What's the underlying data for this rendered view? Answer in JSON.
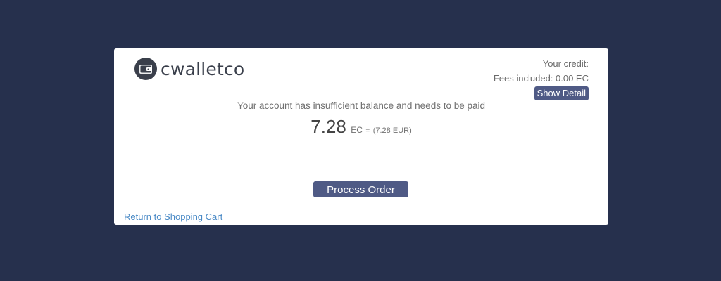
{
  "brand": {
    "name": "cwalletco"
  },
  "credit": {
    "your_credit_label": "Your credit:",
    "fees_label": "Fees included: 0.00 EC",
    "show_detail_label": "Show Detail"
  },
  "payment": {
    "message": "Your account has insufficient balance and needs to be paid",
    "amount": "7.28",
    "unit": "EC",
    "equals": "=",
    "fiat": "(7.28 EUR)"
  },
  "actions": {
    "process_label": "Process Order",
    "return_label": "Return to Shopping Cart"
  },
  "colors": {
    "background": "#26304d",
    "button": "#4f5a85",
    "link": "#4a8ac6"
  }
}
